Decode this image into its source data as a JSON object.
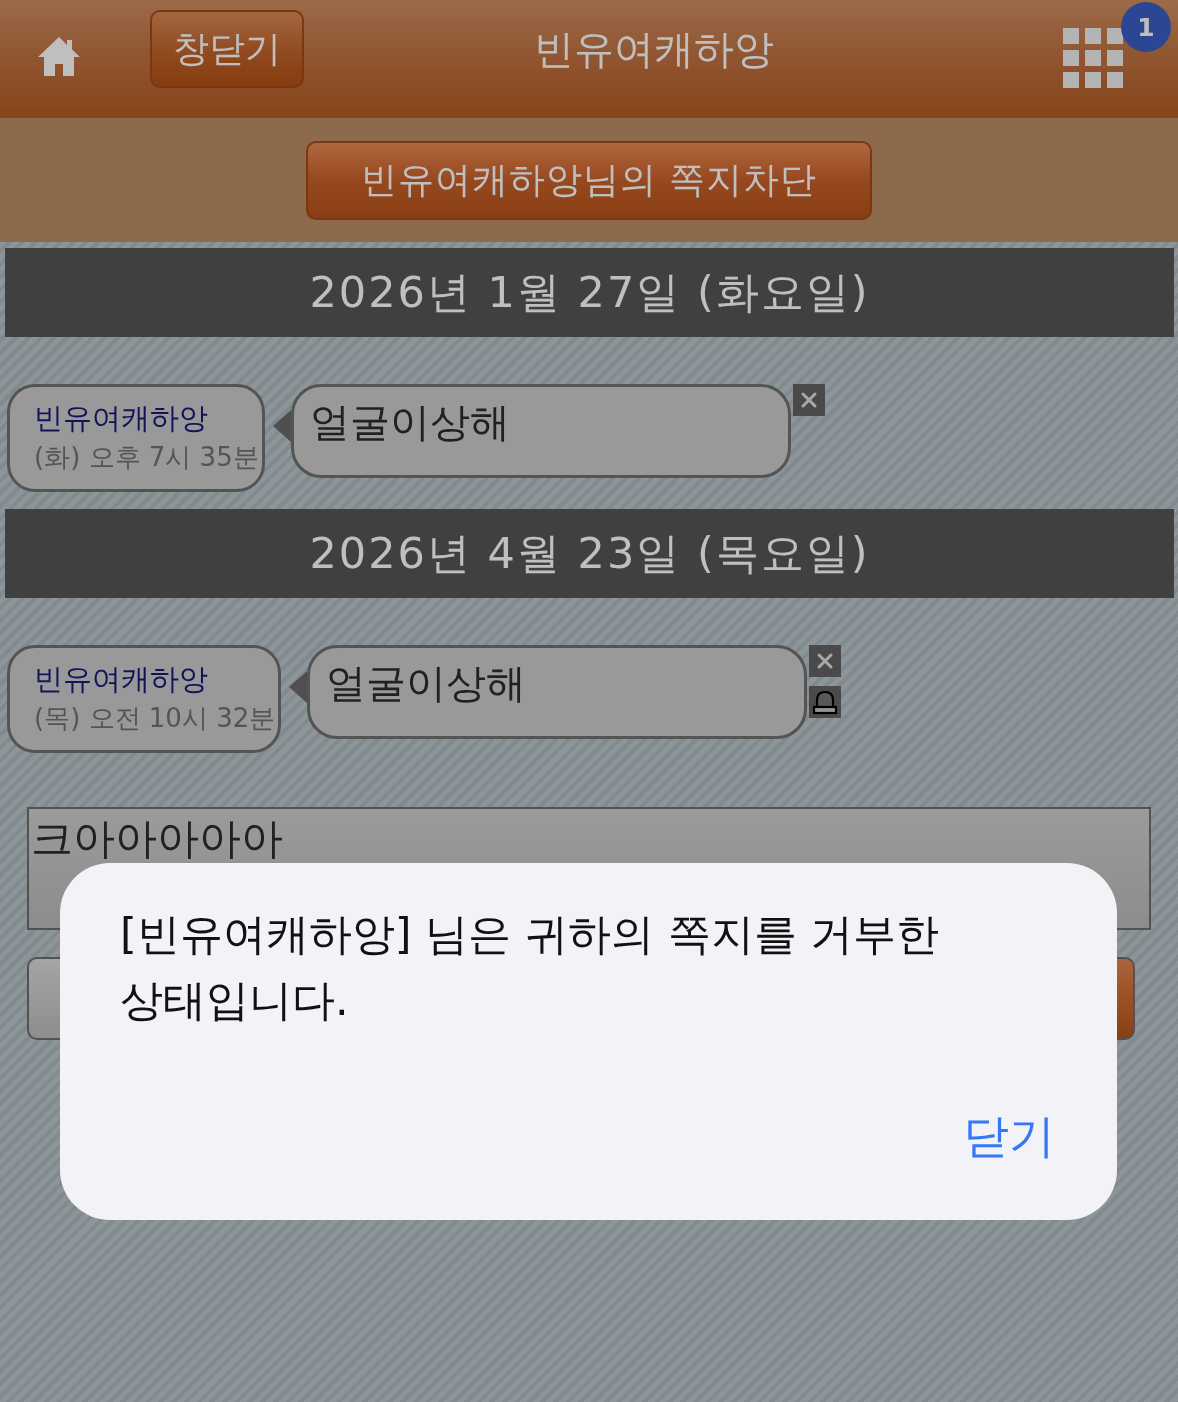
{
  "header": {
    "close_button": "창닫기",
    "title": "빈유여캐하앙",
    "notification_count": "1"
  },
  "block_button": "빈유여캐하앙님의 쪽지차단",
  "days": [
    {
      "date": "2026년 1월 27일 (화요일)",
      "messages": [
        {
          "sender": "빈유여캐하앙",
          "time": "(화) 오후 7시 35분",
          "text": "얼굴이상해",
          "actions": [
            {
              "kind": "delete"
            }
          ]
        }
      ]
    },
    {
      "date": "2026년 4월 23일 (목요일)",
      "messages": [
        {
          "sender": "빈유여캐하앙",
          "time": "(목) 오전 10시 32분",
          "text": "얼굴이상해",
          "actions": [
            {
              "kind": "delete"
            },
            {
              "kind": "bell"
            }
          ]
        }
      ]
    }
  ],
  "compose": {
    "value": "크아아아아아"
  },
  "dialog": {
    "message": "[빈유여캐하앙] 님은 귀하의 쪽지를 거부한 상태입니다.",
    "button": "닫기"
  }
}
